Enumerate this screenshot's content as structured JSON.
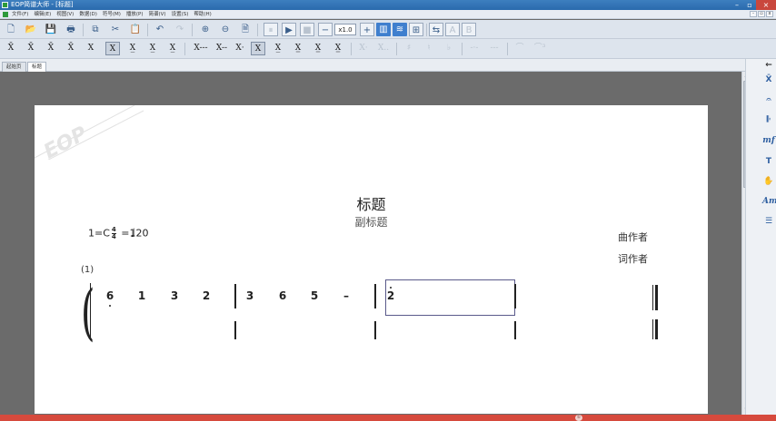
{
  "window": {
    "title": "EOP简谱大师 - [标题]"
  },
  "menu": {
    "items": [
      "文件(F)",
      "编辑(E)",
      "视图(V)",
      "数据(D)",
      "符号(M)",
      "播放(P)",
      "简谱(V)",
      "设置(S)",
      "帮助(H)"
    ]
  },
  "toolbar": {
    "zoom": "x1.0"
  },
  "tabs": [
    {
      "label": "起始页"
    },
    {
      "label": "标题"
    }
  ],
  "score": {
    "title": "标题",
    "subtitle": "副标题",
    "key_prefix": "1=C",
    "time_top": "4",
    "time_bottom": "4",
    "tempo_note": "♩",
    "tempo": "=120",
    "composer": "曲作者",
    "lyricist": "词作者",
    "measure_number": "(1)",
    "measures": [
      {
        "notes": [
          {
            "text": "6",
            "dot_below": true
          },
          {
            "text": "1",
            "dot_below": false
          },
          {
            "text": "3",
            "dot_below": false
          },
          {
            "text": "2",
            "dot_below": false
          }
        ]
      },
      {
        "notes": [
          {
            "text": "3",
            "dot_below": false
          },
          {
            "text": "6",
            "dot_below": false
          },
          {
            "text": "5",
            "dot_below": false
          },
          {
            "text": "–",
            "dot_below": false
          }
        ]
      },
      {
        "notes": [
          {
            "text": "2",
            "dot_above": true
          }
        ]
      }
    ]
  },
  "watermark": "EOP",
  "status": {
    "page_indicator": "①"
  },
  "colors": {
    "accent": "#3f7fce",
    "status_bar": "#d64a3d",
    "titlebar": "#2a6aad"
  }
}
